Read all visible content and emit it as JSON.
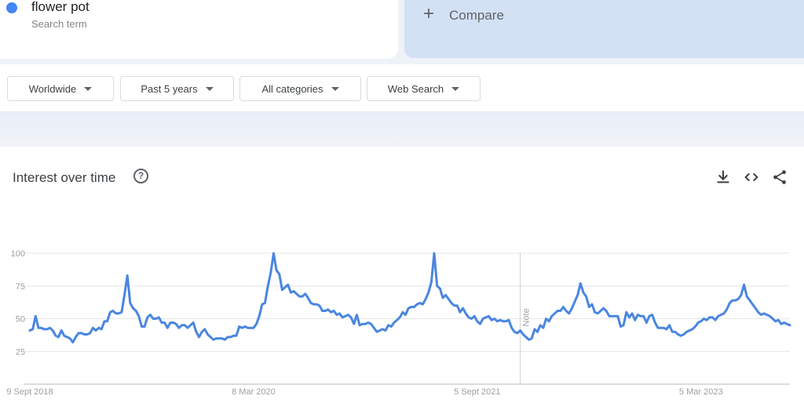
{
  "search_term": {
    "name": "flower pot",
    "subtitle": "Search term",
    "color": "#4285f4"
  },
  "compare": {
    "label": "Compare",
    "icon": "plus-icon"
  },
  "filters": [
    {
      "label": "Worldwide"
    },
    {
      "label": "Past 5 years"
    },
    {
      "label": "All categories"
    },
    {
      "label": "Web Search"
    }
  ],
  "card": {
    "title": "Interest over time",
    "help_icon": "question-circle-icon",
    "tools": [
      "download-icon",
      "embed-code-icon",
      "share-icon"
    ]
  },
  "chart_data": {
    "type": "line",
    "title": "Interest over time",
    "xlabel": "",
    "ylabel": "",
    "ylim": [
      0,
      100
    ],
    "yticks": [
      25,
      50,
      75,
      100
    ],
    "grid": true,
    "line_color": "#4a86e0",
    "x_tick_labels": [
      {
        "label": "9 Sept 2018",
        "index": 0
      },
      {
        "label": "8 Mar 2020",
        "index": 78
      },
      {
        "label": "5 Sept 2021",
        "index": 156
      },
      {
        "label": "5 Mar 2023",
        "index": 234
      }
    ],
    "annotation": {
      "label": "Note",
      "index": 171
    },
    "series": [
      {
        "name": "flower pot",
        "frequency": "weekly",
        "start": "9 Sept 2018",
        "values": [
          41,
          42,
          52,
          43,
          43,
          42,
          42,
          43,
          41,
          37,
          36,
          41,
          37,
          36,
          35,
          32,
          36,
          39,
          39,
          38,
          38,
          39,
          43,
          41,
          43,
          42,
          48,
          48,
          55,
          56,
          54,
          54,
          55,
          68,
          83,
          62,
          58,
          56,
          52,
          44,
          44,
          51,
          53,
          50,
          50,
          51,
          47,
          47,
          43,
          47,
          47,
          46,
          43,
          45,
          45,
          43,
          45,
          47,
          40,
          36,
          40,
          42,
          38,
          36,
          34,
          35,
          35,
          35,
          34,
          36,
          36,
          37,
          37,
          44,
          43,
          44,
          43,
          43,
          43,
          46,
          52,
          61,
          62,
          75,
          85,
          100,
          87,
          84,
          72,
          74,
          76,
          70,
          71,
          69,
          67,
          67,
          69,
          66,
          62,
          61,
          61,
          60,
          56,
          56,
          57,
          55,
          56,
          53,
          54,
          51,
          52,
          53,
          51,
          46,
          53,
          45,
          46,
          46,
          47,
          46,
          43,
          40,
          41,
          42,
          41,
          45,
          44,
          47,
          49,
          51,
          55,
          53,
          58,
          59,
          59,
          61,
          62,
          61,
          65,
          70,
          78,
          100,
          75,
          73,
          66,
          68,
          65,
          62,
          60,
          60,
          55,
          58,
          54,
          51,
          50,
          52,
          48,
          46,
          50,
          51,
          52,
          49,
          50,
          48,
          49,
          48,
          48,
          49,
          43,
          40,
          39,
          41,
          38,
          36,
          34,
          35,
          42,
          40,
          45,
          43,
          50,
          48,
          52,
          54,
          56,
          56,
          59,
          56,
          54,
          58,
          63,
          68,
          77,
          70,
          67,
          59,
          61,
          55,
          54,
          56,
          58,
          56,
          52,
          52,
          52,
          52,
          44,
          45,
          55,
          51,
          54,
          49,
          53,
          52,
          52,
          47,
          52,
          53,
          47,
          43,
          43,
          43,
          42,
          45,
          40,
          40,
          38,
          37,
          38,
          40,
          41,
          42,
          44,
          47,
          48,
          50,
          49,
          51,
          51,
          49,
          52,
          53,
          54,
          57,
          62,
          64,
          64,
          65,
          68,
          76,
          67,
          64,
          61,
          58,
          55,
          53,
          54,
          53,
          52,
          50,
          48,
          49,
          46,
          47,
          46,
          45
        ]
      }
    ]
  }
}
